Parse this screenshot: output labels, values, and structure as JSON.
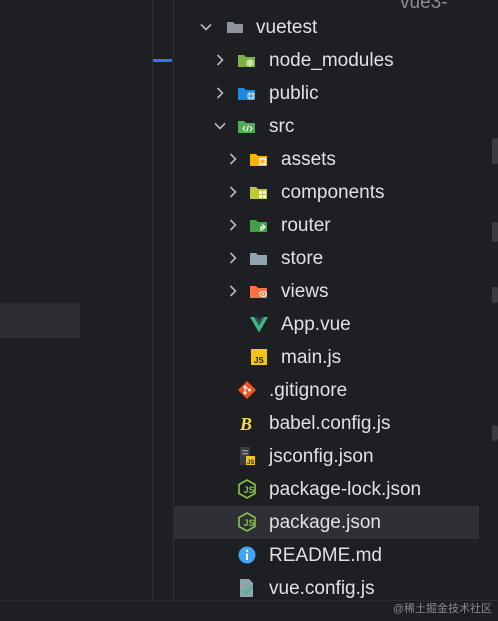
{
  "tree": {
    "top_cut_label": "vue3-",
    "items": [
      {
        "label": "vuetest",
        "icon": "folder-open-icon"
      },
      {
        "label": "node_modules",
        "icon": "node-folder-icon"
      },
      {
        "label": "public",
        "icon": "public-folder-icon"
      },
      {
        "label": "src",
        "icon": "src-folder-icon"
      },
      {
        "label": "assets",
        "icon": "assets-folder-icon"
      },
      {
        "label": "components",
        "icon": "components-folder-icon"
      },
      {
        "label": "router",
        "icon": "router-folder-icon"
      },
      {
        "label": "store",
        "icon": "folder-icon"
      },
      {
        "label": "views",
        "icon": "views-folder-icon"
      },
      {
        "label": "App.vue",
        "icon": "vue-file-icon"
      },
      {
        "label": "main.js",
        "icon": "js-file-icon"
      },
      {
        "label": ".gitignore",
        "icon": "git-icon"
      },
      {
        "label": "babel.config.js",
        "icon": "babel-icon"
      },
      {
        "label": "jsconfig.json",
        "icon": "jsconfig-icon"
      },
      {
        "label": "package-lock.json",
        "icon": "node-json-icon"
      },
      {
        "label": "package.json",
        "icon": "node-json-icon"
      },
      {
        "label": "README.md",
        "icon": "info-icon"
      },
      {
        "label": "vue.config.js",
        "icon": "vue-config-icon"
      }
    ]
  },
  "watermark": "@稀土掘金技术社区",
  "colors": {
    "background": "#1e1f22",
    "selected_row": "#2e3036",
    "text": "#dfe1e5",
    "accent": "#3574f0"
  }
}
